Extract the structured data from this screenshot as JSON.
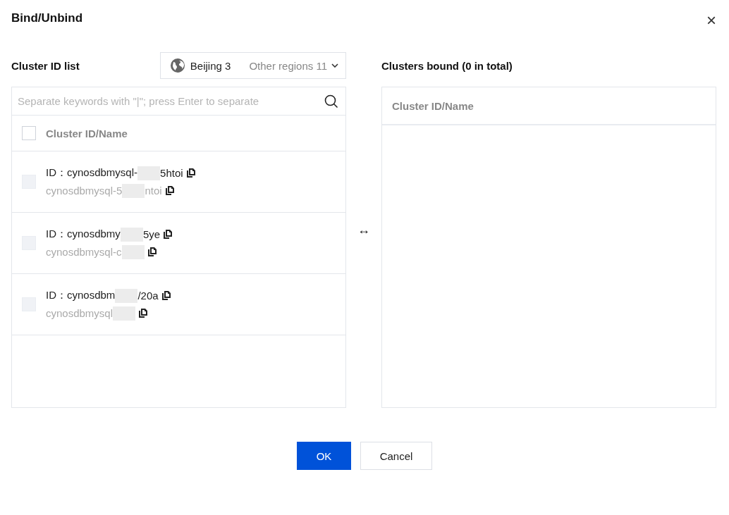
{
  "dialog": {
    "title": "Bind/Unbind",
    "close": "×"
  },
  "left": {
    "title": "Cluster ID list",
    "region": {
      "current": "Beijing 3",
      "other": "Other regions 11"
    },
    "search": {
      "placeholder": "Separate keywords with \"|\"; press Enter to separate"
    },
    "header": {
      "label": "Cluster ID/Name",
      "checked": false
    },
    "rows": [
      {
        "id_parts": [
          "ID：cynosdbmysql-",
          "5htoi"
        ],
        "name_parts": [
          "cynosdbmysql-5",
          "ntoi"
        ],
        "disabled": true
      },
      {
        "id_parts": [
          "ID：cynosdbmy",
          "5ye"
        ],
        "name_parts": [
          "cynosdbmysql-c"
        ],
        "disabled": true
      },
      {
        "id_parts": [
          "ID：cynosdbm",
          "/20a"
        ],
        "name_parts": [
          "cynosdbmysql"
        ],
        "disabled": true
      }
    ]
  },
  "transfer": "↔",
  "right": {
    "title": "Clusters bound (0 in total)",
    "header": "Cluster ID/Name"
  },
  "buttons": [
    {
      "label": "OK",
      "kind": "primary"
    },
    {
      "label": "Cancel",
      "kind": "default"
    }
  ]
}
